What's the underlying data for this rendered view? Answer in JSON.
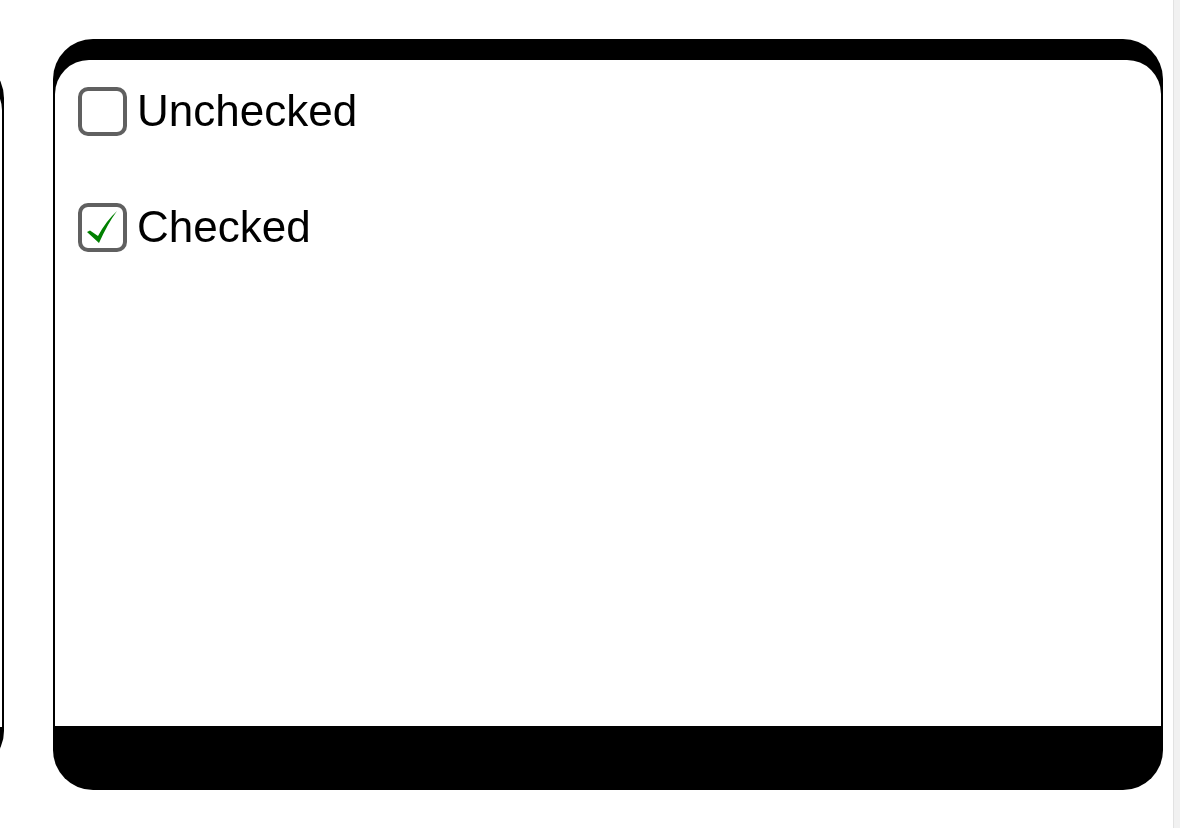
{
  "checkboxes": [
    {
      "label": "Unchecked",
      "checked": false
    },
    {
      "label": "Checked",
      "checked": true
    }
  ]
}
